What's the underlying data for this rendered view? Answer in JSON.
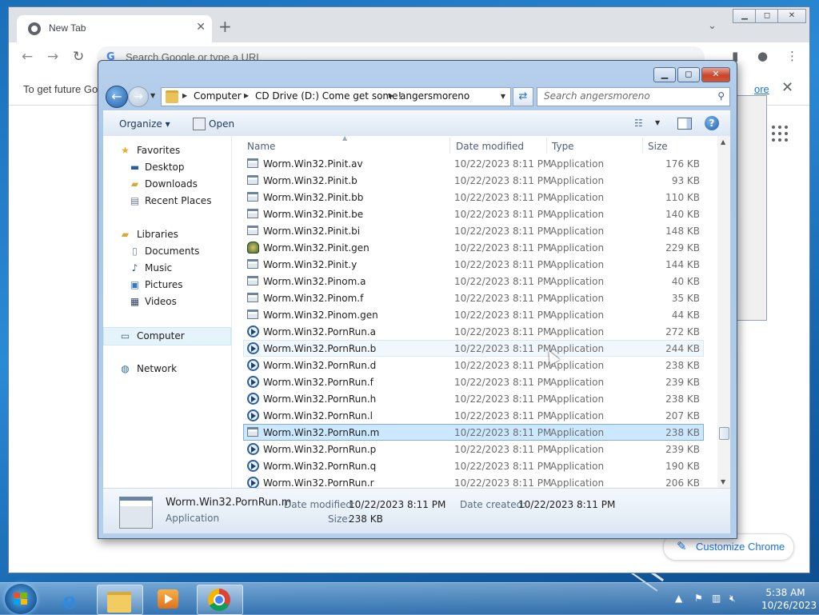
{
  "browser": {
    "tab_title": "New Tab",
    "omnibox_placeholder": "Search Google or type a URL",
    "infobar_text": "To get future Go",
    "infobar_link": "ore",
    "customize_label": "Customize Chrome"
  },
  "dialog": {
    "breadcrumb": [
      "Computer",
      "CD Drive (D:) Come get some!",
      "angersmoreno"
    ],
    "search_placeholder": "Search angersmoreno",
    "toolbar": {
      "organize": "Organize",
      "open": "Open"
    },
    "nav": {
      "favorites": "Favorites",
      "desktop": "Desktop",
      "downloads": "Downloads",
      "recent": "Recent Places",
      "libraries": "Libraries",
      "documents": "Documents",
      "music": "Music",
      "pictures": "Pictures",
      "videos": "Videos",
      "computer": "Computer",
      "network": "Network"
    },
    "columns": {
      "name": "Name",
      "date": "Date modified",
      "type": "Type",
      "size": "Size"
    },
    "files": [
      {
        "name": "Worm.Win32.Pinit.av",
        "date": "10/22/2023 8:11 PM",
        "type": "Application",
        "size": "176 KB",
        "icon": "exe-window-icon"
      },
      {
        "name": "Worm.Win32.Pinit.b",
        "date": "10/22/2023 8:11 PM",
        "type": "Application",
        "size": "93 KB",
        "icon": "exe-window-icon"
      },
      {
        "name": "Worm.Win32.Pinit.bb",
        "date": "10/22/2023 8:11 PM",
        "type": "Application",
        "size": "110 KB",
        "icon": "exe-window-icon"
      },
      {
        "name": "Worm.Win32.Pinit.be",
        "date": "10/22/2023 8:11 PM",
        "type": "Application",
        "size": "140 KB",
        "icon": "exe-window-icon"
      },
      {
        "name": "Worm.Win32.Pinit.bi",
        "date": "10/22/2023 8:11 PM",
        "type": "Application",
        "size": "148 KB",
        "icon": "exe-window-icon"
      },
      {
        "name": "Worm.Win32.Pinit.gen",
        "date": "10/22/2023 8:11 PM",
        "type": "Application",
        "size": "229 KB",
        "icon": "exe-custom-icon"
      },
      {
        "name": "Worm.Win32.Pinit.y",
        "date": "10/22/2023 8:11 PM",
        "type": "Application",
        "size": "144 KB",
        "icon": "exe-window-icon"
      },
      {
        "name": "Worm.Win32.Pinom.a",
        "date": "10/22/2023 8:11 PM",
        "type": "Application",
        "size": "40 KB",
        "icon": "exe-window-icon"
      },
      {
        "name": "Worm.Win32.Pinom.f",
        "date": "10/22/2023 8:11 PM",
        "type": "Application",
        "size": "35 KB",
        "icon": "exe-window-icon"
      },
      {
        "name": "Worm.Win32.Pinom.gen",
        "date": "10/22/2023 8:11 PM",
        "type": "Application",
        "size": "44 KB",
        "icon": "exe-window-icon"
      },
      {
        "name": "Worm.Win32.PornRun.a",
        "date": "10/22/2023 8:11 PM",
        "type": "Application",
        "size": "272 KB",
        "icon": "exe-media-icon"
      },
      {
        "name": "Worm.Win32.PornRun.b",
        "date": "10/22/2023 8:11 PM",
        "type": "Application",
        "size": "244 KB",
        "icon": "exe-media-icon",
        "state": "hover"
      },
      {
        "name": "Worm.Win32.PornRun.d",
        "date": "10/22/2023 8:11 PM",
        "type": "Application",
        "size": "238 KB",
        "icon": "exe-media-icon"
      },
      {
        "name": "Worm.Win32.PornRun.f",
        "date": "10/22/2023 8:11 PM",
        "type": "Application",
        "size": "239 KB",
        "icon": "exe-media-icon"
      },
      {
        "name": "Worm.Win32.PornRun.h",
        "date": "10/22/2023 8:11 PM",
        "type": "Application",
        "size": "238 KB",
        "icon": "exe-media-icon"
      },
      {
        "name": "Worm.Win32.PornRun.l",
        "date": "10/22/2023 8:11 PM",
        "type": "Application",
        "size": "207 KB",
        "icon": "exe-media-icon"
      },
      {
        "name": "Worm.Win32.PornRun.m",
        "date": "10/22/2023 8:11 PM",
        "type": "Application",
        "size": "238 KB",
        "icon": "exe-window-icon",
        "state": "selected"
      },
      {
        "name": "Worm.Win32.PornRun.p",
        "date": "10/22/2023 8:11 PM",
        "type": "Application",
        "size": "239 KB",
        "icon": "exe-media-icon"
      },
      {
        "name": "Worm.Win32.PornRun.q",
        "date": "10/22/2023 8:11 PM",
        "type": "Application",
        "size": "190 KB",
        "icon": "exe-media-icon"
      },
      {
        "name": "Worm.Win32.PornRun.r",
        "date": "10/22/2023 8:11 PM",
        "type": "Application",
        "size": "206 KB",
        "icon": "exe-media-icon"
      }
    ],
    "details": {
      "name": "Worm.Win32.PornRun.m",
      "type": "Application",
      "date_modified_label": "Date modified:",
      "date_modified": "10/22/2023 8:11 PM",
      "date_created_label": "Date created:",
      "date_created": "10/22/2023 8:11 PM",
      "size_label": "Size:",
      "size": "238 KB"
    }
  },
  "taskbar": {
    "clock_time": "5:38 AM",
    "clock_date": "10/26/2023",
    "pinned": [
      "internet-explorer-icon",
      "windows-explorer-icon",
      "media-player-icon",
      "chrome-icon"
    ]
  },
  "colors": {
    "desktop": "#1a6fb8",
    "selection": "#cce8ff",
    "link": "#1a73e8"
  }
}
